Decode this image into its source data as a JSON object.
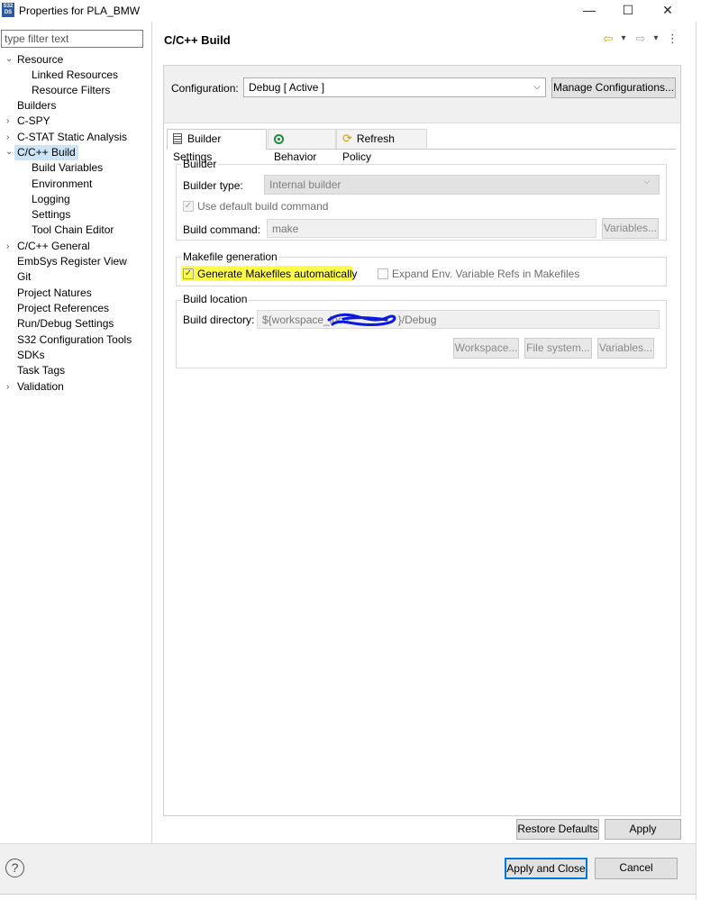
{
  "window": {
    "icon_text": "S32 DS",
    "title": "Properties for PLA_BMW",
    "minimize": "—",
    "maximize": "☐",
    "close": "✕"
  },
  "filter": {
    "placeholder": "type filter text"
  },
  "tree": [
    {
      "label": "Resource",
      "expandable": true,
      "expanded": true,
      "level": 0
    },
    {
      "label": "Linked Resources",
      "level": 1
    },
    {
      "label": "Resource Filters",
      "level": 1
    },
    {
      "label": "Builders",
      "level": 0
    },
    {
      "label": "C-SPY",
      "expandable": true,
      "level": 0
    },
    {
      "label": "C-STAT Static Analysis",
      "expandable": true,
      "level": 0
    },
    {
      "label": "C/C++ Build",
      "expandable": true,
      "expanded": true,
      "selected": true,
      "level": 0
    },
    {
      "label": "Build Variables",
      "level": 1
    },
    {
      "label": "Environment",
      "level": 1
    },
    {
      "label": "Logging",
      "level": 1
    },
    {
      "label": "Settings",
      "level": 1
    },
    {
      "label": "Tool Chain Editor",
      "level": 1
    },
    {
      "label": "C/C++ General",
      "expandable": true,
      "level": 0
    },
    {
      "label": "EmbSys Register View",
      "level": 0
    },
    {
      "label": "Git",
      "level": 0
    },
    {
      "label": "Project Natures",
      "level": 0
    },
    {
      "label": "Project References",
      "level": 0
    },
    {
      "label": "Run/Debug Settings",
      "level": 0
    },
    {
      "label": "S32 Configuration Tools",
      "level": 0
    },
    {
      "label": "SDKs",
      "level": 0
    },
    {
      "label": "Task Tags",
      "level": 0
    },
    {
      "label": "Validation",
      "expandable": true,
      "level": 0
    }
  ],
  "page": {
    "title": "C/C++ Build",
    "nav_icons": {
      "back": "⇦",
      "dropdown": "▾",
      "forward": "⇨",
      "menu": "⋮"
    }
  },
  "configuration": {
    "label": "Configuration:",
    "value": "Debug  [ Active ]",
    "manage_label": "Manage Configurations..."
  },
  "tabs": [
    {
      "label": "Builder Settings",
      "active": true,
      "icon": "builder-settings-icon"
    },
    {
      "label": "Behavior",
      "active": false,
      "icon": "behavior-icon"
    },
    {
      "label": "Refresh Policy",
      "active": false,
      "icon": "refresh-policy-icon"
    }
  ],
  "builder": {
    "group_title": "Builder",
    "type_label": "Builder type:",
    "type_value": "Internal builder",
    "use_default_label": "Use default build command",
    "use_default_checked": true,
    "command_label": "Build command:",
    "command_value": "make",
    "variables_label": "Variables..."
  },
  "makefile": {
    "group_title": "Makefile generation",
    "generate_label": "Generate Makefiles automatically",
    "generate_checked": true,
    "expand_label": "Expand Env. Variable Refs in Makefiles",
    "expand_checked": false
  },
  "location": {
    "group_title": "Build location",
    "dir_label": "Build directory:",
    "dir_prefix": "${workspace_loc:/",
    "dir_suffix": "}/Debug",
    "workspace_label": "Workspace...",
    "filesystem_label": "File system...",
    "variables_label": "Variables..."
  },
  "footer": {
    "restore_label": "Restore Defaults",
    "apply_label": "Apply",
    "apply_close_label": "Apply and Close",
    "cancel_label": "Cancel",
    "help": "?"
  },
  "colors": {
    "highlight": "#ffff4a",
    "selection": "#cce4f7",
    "scribble": "#0a18e0",
    "focus_border": "#0078d7"
  }
}
